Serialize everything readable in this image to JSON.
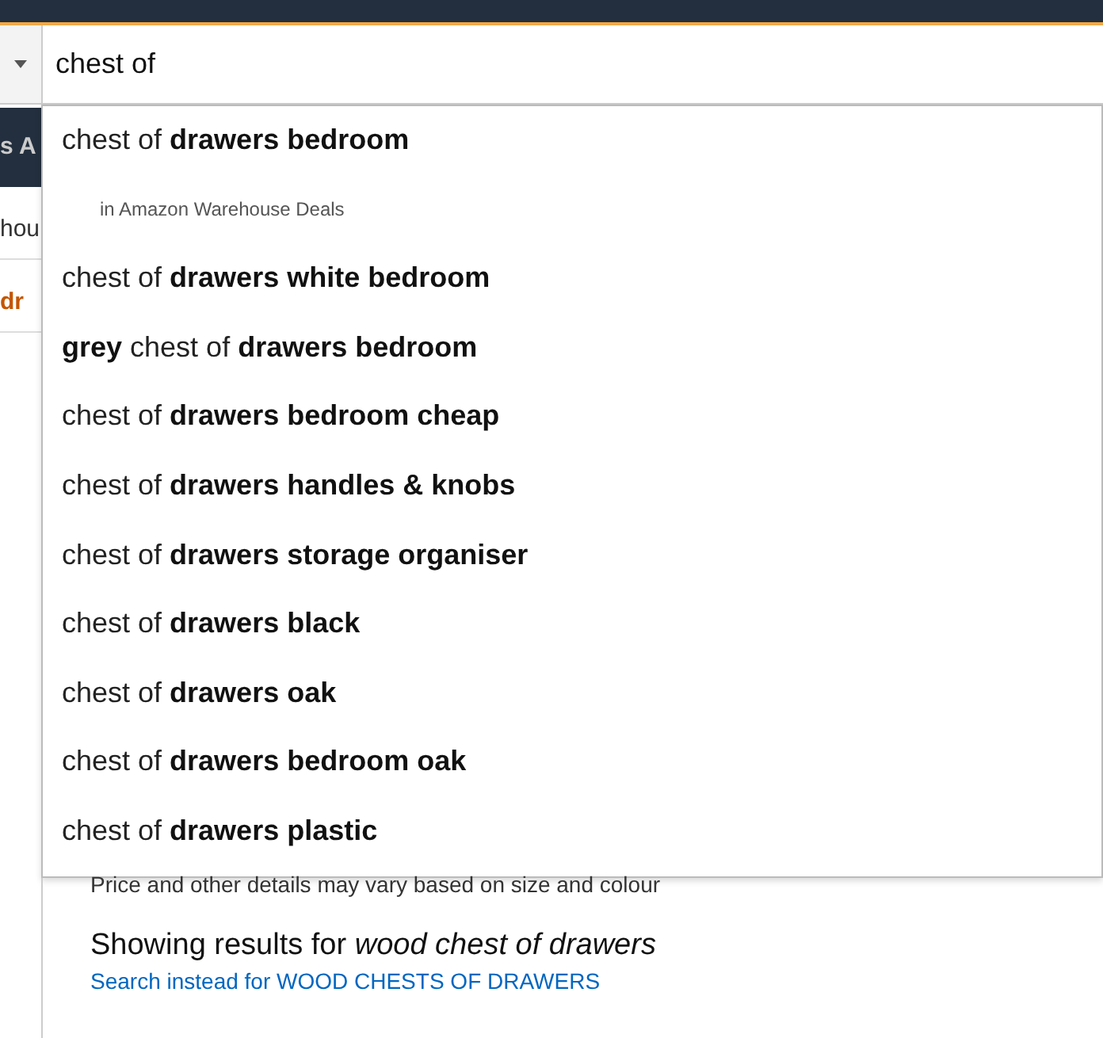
{
  "search": {
    "value": "chest of"
  },
  "left_fragments": [
    {
      "kind": "dark",
      "text": "s A"
    },
    {
      "kind": "plain",
      "text": "hou"
    },
    {
      "kind": "accent",
      "text": "dr"
    }
  ],
  "suggestions": [
    {
      "kind": "query",
      "text": "chest of **drawers bedroom**"
    },
    {
      "kind": "department",
      "text": "in Amazon Warehouse Deals"
    },
    {
      "kind": "query",
      "text": "chest of **drawers white bedroom**"
    },
    {
      "kind": "query",
      "text": "**grey** chest of **drawers bedroom**"
    },
    {
      "kind": "query",
      "text": "chest of **drawers bedroom cheap**"
    },
    {
      "kind": "query",
      "text": "chest of **drawers handles & knobs**"
    },
    {
      "kind": "query",
      "text": "chest of **drawers storage organiser**"
    },
    {
      "kind": "query",
      "text": "chest of **drawers black**"
    },
    {
      "kind": "query",
      "text": "chest of **drawers oak**"
    },
    {
      "kind": "query",
      "text": "chest of **drawers bedroom oak**"
    },
    {
      "kind": "query",
      "text": "chest of **drawers plastic**"
    }
  ],
  "results": {
    "note": "Price and other details may vary based on size and colour",
    "showing_prefix": "Showing results for",
    "showing_query": "wood chest of drawers",
    "search_instead": "Search instead for WOOD CHESTS OF DRAWERS"
  }
}
